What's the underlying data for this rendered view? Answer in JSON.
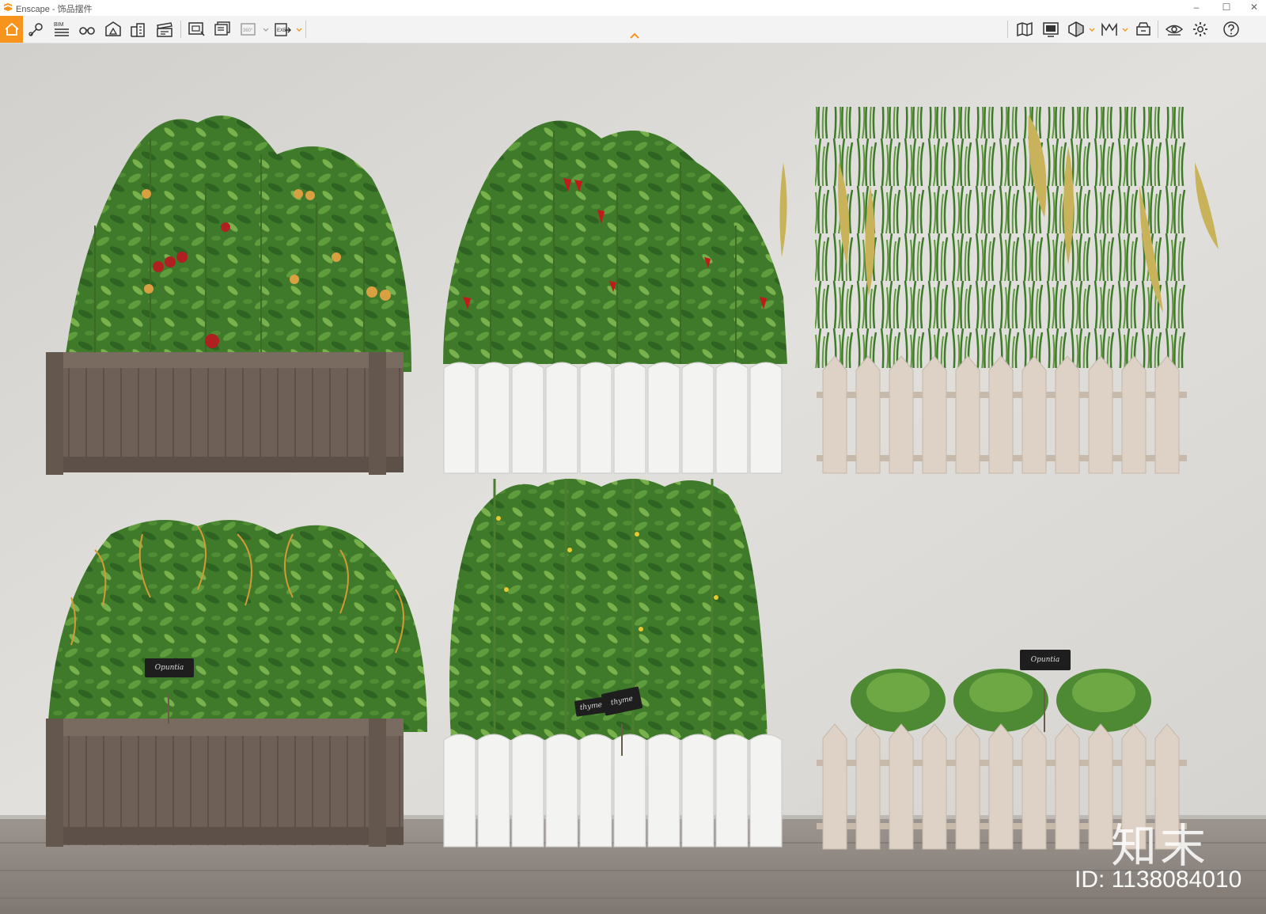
{
  "window": {
    "title": "Enscape - 饰品摆件"
  },
  "toolbar": {
    "left_icons": [
      "home-icon",
      "location-pin-icon",
      "bim-icon",
      "bim-list-icon",
      "binoculars-icon",
      "terrain-icon",
      "buildings-icon",
      "clapper-icon",
      "screenshot-icon",
      "batch-render-icon",
      "panorama-360-icon",
      "export-exe-icon"
    ],
    "bim_label": "BIM",
    "panorama_label": "360°",
    "exe_label": "EXE",
    "right_icons": [
      "map-icon",
      "render-window-icon",
      "section-icon",
      "views-icon",
      "asset-library-icon",
      "visibility-icon",
      "settings-icon",
      "help-icon"
    ]
  },
  "viewport": {
    "plant_labels": [
      "Opuntia",
      "thyme",
      "thyme",
      "Opuntia"
    ],
    "watermark_logo": "知末",
    "watermark_id": "ID: 1138084010"
  },
  "colors": {
    "accent": "#f7941d",
    "wall": "#dcdad6",
    "floor": "#8b8480",
    "dark_planter": "#6b5d52",
    "white_planter": "#f0f0ef",
    "beige_planter": "#d9cdbf"
  }
}
